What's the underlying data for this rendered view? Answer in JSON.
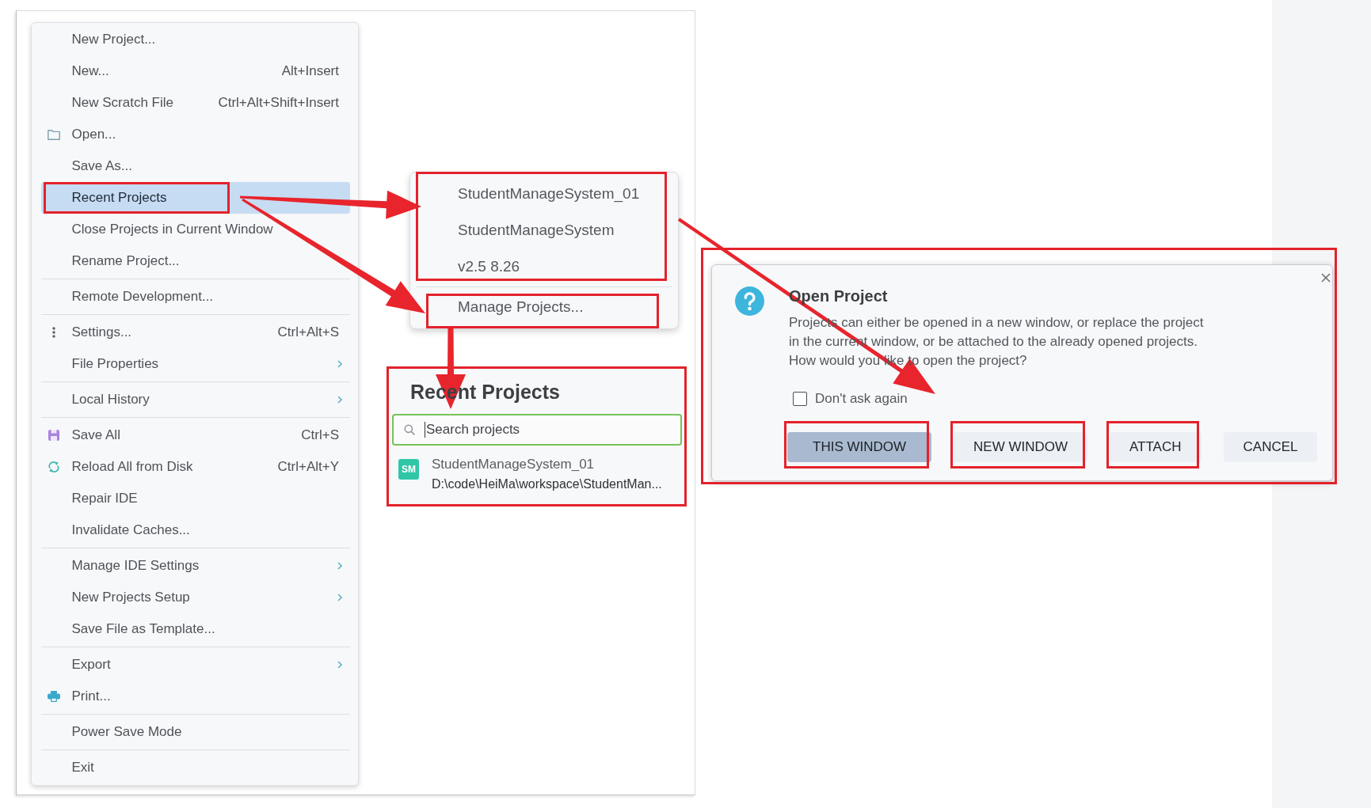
{
  "file_menu": {
    "items": [
      {
        "kind": "item",
        "label": "New Project...",
        "selected": false,
        "submenu": false,
        "outlined": false
      },
      {
        "kind": "item",
        "label": "New...",
        "shortcut": "Alt+Insert",
        "selected": false,
        "submenu": false,
        "outlined": false
      },
      {
        "kind": "item",
        "label": "New Scratch File",
        "shortcut": "Ctrl+Alt+Shift+Insert",
        "selected": false,
        "submenu": false,
        "outlined": false
      },
      {
        "kind": "item",
        "label": "Open...",
        "selected": false,
        "submenu": false,
        "outlined": false
      },
      {
        "kind": "item",
        "label": "Save As...",
        "selected": false,
        "submenu": false,
        "outlined": false
      },
      {
        "kind": "item",
        "label": "Recent Projects",
        "selected": true,
        "submenu": false,
        "outlined": true
      },
      {
        "kind": "item",
        "label": "Close Projects in Current Window",
        "selected": false,
        "submenu": false,
        "outlined": false
      },
      {
        "kind": "item",
        "label": "Rename Project...",
        "selected": false,
        "submenu": false,
        "outlined": false
      },
      {
        "kind": "separator"
      },
      {
        "kind": "item",
        "label": "Remote Development...",
        "selected": false,
        "submenu": false,
        "outlined": false
      },
      {
        "kind": "separator"
      },
      {
        "kind": "item",
        "label": "Settings...",
        "shortcut": "Ctrl+Alt+S",
        "selected": false,
        "submenu": false,
        "outlined": false
      },
      {
        "kind": "item",
        "label": "File Properties",
        "selected": false,
        "submenu": true,
        "outlined": false
      },
      {
        "kind": "separator"
      },
      {
        "kind": "item",
        "label": "Local History",
        "selected": false,
        "submenu": true,
        "outlined": false
      },
      {
        "kind": "separator"
      },
      {
        "kind": "item",
        "label": "Save All",
        "shortcut": "Ctrl+S",
        "selected": false,
        "submenu": false,
        "outlined": false
      },
      {
        "kind": "item",
        "label": "Reload All from Disk",
        "shortcut": "Ctrl+Alt+Y",
        "selected": false,
        "submenu": false,
        "outlined": false
      },
      {
        "kind": "item",
        "label": "Repair IDE",
        "selected": false,
        "submenu": false,
        "outlined": false
      },
      {
        "kind": "item",
        "label": "Invalidate Caches...",
        "selected": false,
        "submenu": false,
        "outlined": false
      },
      {
        "kind": "separator"
      },
      {
        "kind": "item",
        "label": "Manage IDE Settings",
        "selected": false,
        "submenu": true,
        "outlined": false
      },
      {
        "kind": "item",
        "label": "New Projects Setup",
        "selected": false,
        "submenu": true,
        "outlined": false
      },
      {
        "kind": "item",
        "label": "Save File as Template...",
        "selected": false,
        "submenu": false,
        "outlined": false
      },
      {
        "kind": "separator"
      },
      {
        "kind": "item",
        "label": "Export",
        "selected": false,
        "submenu": true,
        "outlined": false
      },
      {
        "kind": "item",
        "label": "Print...",
        "selected": false,
        "submenu": false,
        "outlined": false
      },
      {
        "kind": "separator"
      },
      {
        "kind": "item",
        "label": "Power Save Mode",
        "selected": false,
        "submenu": false,
        "outlined": false
      },
      {
        "kind": "separator"
      },
      {
        "kind": "item",
        "label": "Exit",
        "selected": false,
        "submenu": false,
        "outlined": false
      }
    ]
  },
  "recent_menu": {
    "projects_outlined": true,
    "projects": [
      {
        "label": "StudentManageSystem_01",
        "selected": false
      },
      {
        "label": "StudentManageSystem",
        "selected": false
      },
      {
        "label": "v2.5 8.26",
        "selected": false
      }
    ],
    "manage": {
      "label": "Manage Projects...",
      "outlined": true
    }
  },
  "recent_panel": {
    "outlined": true,
    "title": "Recent Projects",
    "search": {
      "placeholder": "Search projects",
      "focused": true
    },
    "projects": [
      {
        "badge": "SM",
        "color": "#2fc6a6",
        "name": "StudentManageSystem_01",
        "path": "D:\\code\\HeiMa\\workspace\\StudentMan..."
      }
    ]
  },
  "dialog": {
    "outlined": true,
    "title": "Open Project",
    "message_lines": [
      "Projects can either be opened in a new window, or replace the project",
      "in the current window, or be attached to the already opened projects.",
      "How would you like to open the project?"
    ],
    "checkbox": {
      "label": "Don't ask again",
      "checked": false
    },
    "buttons": [
      {
        "label": "THIS WINDOW",
        "default": true,
        "outlined": true
      },
      {
        "label": "NEW WINDOW",
        "default": false,
        "outlined": true
      },
      {
        "label": "ATTACH",
        "default": false,
        "outlined": true
      },
      {
        "label": "CANCEL",
        "default": false,
        "outlined": false
      }
    ]
  }
}
